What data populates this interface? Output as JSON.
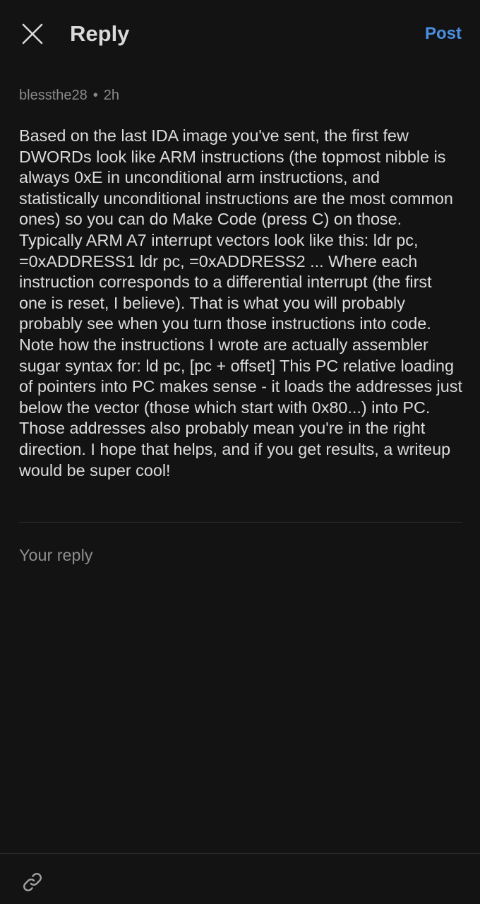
{
  "header": {
    "title": "Reply",
    "post_label": "Post",
    "close_icon": "close-icon"
  },
  "comment": {
    "author": "blessthe28",
    "separator": "•",
    "time": "2h",
    "body": "Based on the last IDA image you've sent, the first few DWORDs look like ARM instructions (the topmost nibble is always 0xE in unconditional arm instructions, and statistically unconditional instructions are the most common ones) so you can do Make Code (press C) on those. Typically ARM A7 interrupt vectors look like this: ldr pc, =0xADDRESS1 ldr pc, =0xADDRESS2 ... Where each instruction corresponds to a differential interrupt (the first one is reset, I believe). That is what you will probably probably see when you turn those instructions into code. Note how the instructions I wrote are actually assembler sugar syntax for: ld pc, [pc + offset] This PC relative loading of pointers into PC makes sense - it loads the addresses just below the vector (those which start with 0x80...) into PC. Those addresses also probably mean you're in the right direction. I hope that helps, and if you get results, a writeup would be super cool!"
  },
  "reply": {
    "placeholder": "Your reply",
    "value": ""
  },
  "toolbar": {
    "link_icon": "link-icon"
  },
  "colors": {
    "background": "#131313",
    "accent": "#4a8fe0",
    "text": "#dcdcdc",
    "muted": "#8a8a8a"
  }
}
